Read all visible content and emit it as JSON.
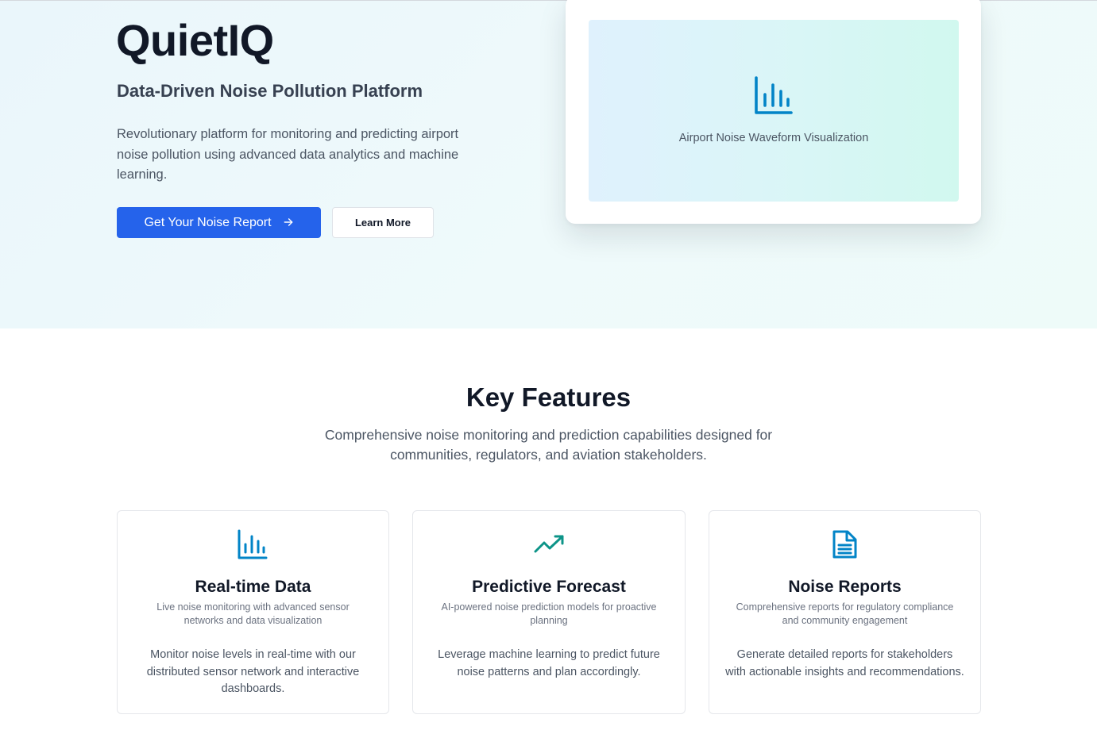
{
  "hero": {
    "title": "QuietIQ",
    "subtitle": "Data-Driven Noise Pollution Platform",
    "description": "Revolutionary platform for monitoring and predicting airport noise pollution using advanced data analytics and machine learning.",
    "primary_button": {
      "label": "Get Your Noise Report",
      "icon": "arrow-right-icon"
    },
    "secondary_button": {
      "label": "Learn More"
    },
    "visualization": {
      "caption": "Airport Noise Waveform Visualization",
      "icon": "bar-chart-icon"
    }
  },
  "features": {
    "title": "Key Features",
    "subtitle": "Comprehensive noise monitoring and prediction capabilities designed for communities, regulators, and aviation stakeholders.",
    "cards": [
      {
        "icon": "bar-chart-icon",
        "title": "Real-time Data",
        "subtitle": "Live noise monitoring with advanced sensor networks and data visualization",
        "body": "Monitor noise levels in real-time with our distributed sensor network and interactive dashboards."
      },
      {
        "icon": "trending-up-icon",
        "title": "Predictive Forecast",
        "subtitle": "AI-powered noise prediction models for proactive planning",
        "body": "Leverage machine learning to predict future noise patterns and plan accordingly."
      },
      {
        "icon": "document-icon",
        "title": "Noise Reports",
        "subtitle": "Comprehensive reports for regulatory compliance and community engagement",
        "body": "Generate detailed reports for stakeholders with actionable insights and recommendations."
      }
    ]
  },
  "colors": {
    "primary": "#2563eb",
    "icon_blue": "#0284c7",
    "icon_teal": "#0d9488",
    "heading": "#111827",
    "text": "#4b5563"
  }
}
